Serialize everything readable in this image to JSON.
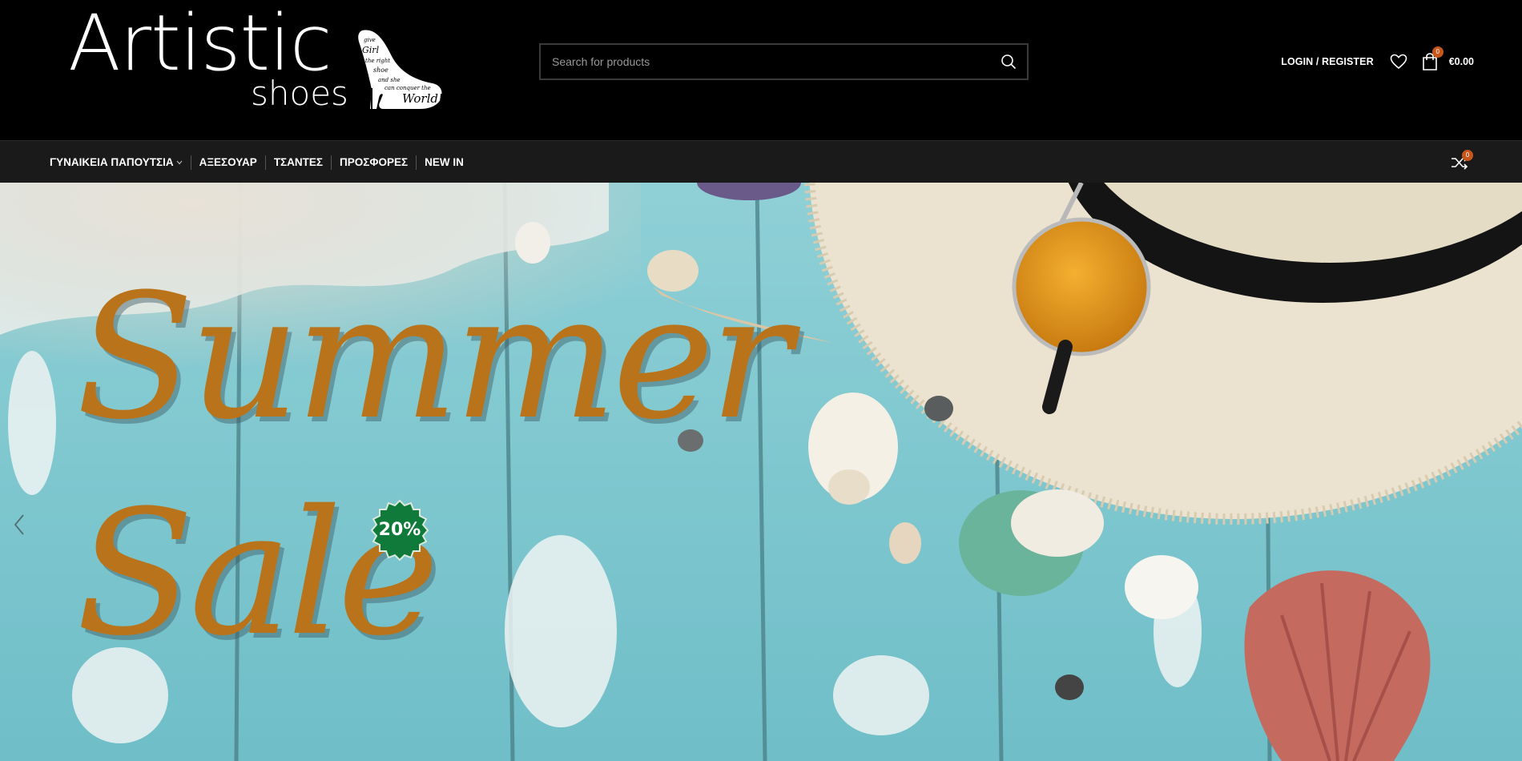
{
  "header": {
    "logo": {
      "word": "Artistic",
      "sub": "shoes",
      "icon": "high-heel-logo-icon"
    },
    "search": {
      "placeholder": "Search for products",
      "icon": "search-icon"
    },
    "login_label": "LOGIN / REGISTER",
    "wishlist_icon": "heart-icon",
    "cart": {
      "icon": "shopping-bag-icon",
      "count": "0",
      "total": "€0.00"
    }
  },
  "nav": {
    "items": [
      {
        "label": "ΓΥΝΑΙΚΕΙΑ ΠΑΠΟΥΤΣΙΑ",
        "has_dropdown": true
      },
      {
        "label": "ΑΞΕΣΟΥΑΡ"
      },
      {
        "label": "ΤΣΑΝΤΕΣ"
      },
      {
        "label": "ΠΡΟΣΦΟΡΕΣ"
      },
      {
        "label": "NEW IN"
      }
    ],
    "compare": {
      "icon": "compare-arrows-icon",
      "count": "0"
    }
  },
  "hero": {
    "line1": "Summer",
    "line2": "Sale",
    "badge": "20%",
    "prev_icon": "chevron-left-icon"
  },
  "colors": {
    "accent": "#c8561b",
    "headline": "#b9731b",
    "badge": "#0f7a3a",
    "nav_bg": "#1a1a1a",
    "wood": "#7fc4cc"
  }
}
